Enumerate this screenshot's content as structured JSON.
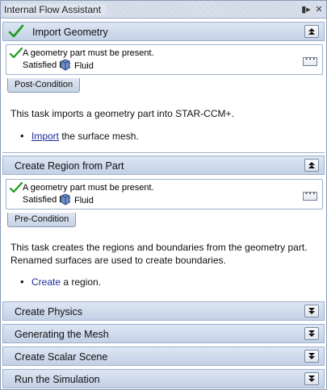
{
  "window": {
    "title": "Internal Flow Assistant"
  },
  "sections": [
    {
      "title": "Import Geometry",
      "completed": true,
      "condition": {
        "message": "A geometry part must be present.",
        "satisfied_label": "Satisfied by:",
        "satisfied_value": "Fluid",
        "tab": "Post-Condition"
      },
      "description": "This task imports a geometry part into STAR-CCM+.",
      "bullet_link": "Import",
      "bullet_rest": " the surface mesh."
    },
    {
      "title": "Create Region from Part",
      "completed": false,
      "condition": {
        "message": "A geometry part must be present.",
        "satisfied_label": "Satisfied by:",
        "satisfied_value": "Fluid",
        "tab": "Pre-Condition"
      },
      "description": "This task creates the regions and boundaries from the geometry part. Renamed surfaces are used to create boundaries.",
      "bullet_link": "Create",
      "bullet_rest": " a region."
    },
    {
      "title": "Create Physics"
    },
    {
      "title": "Generating the Mesh"
    },
    {
      "title": "Create Scalar Scene"
    },
    {
      "title": "Run the Simulation"
    }
  ],
  "icons": {
    "check": "checkmark-icon",
    "collapse": "double-chevron-up-icon",
    "expand": "double-chevron-down-icon",
    "part": "geometry-part-icon",
    "more": "ellipsis-icon"
  },
  "colors": {
    "check": "#1f9b1f",
    "link": "#1a2a9a",
    "header": "#c3d1e6"
  }
}
